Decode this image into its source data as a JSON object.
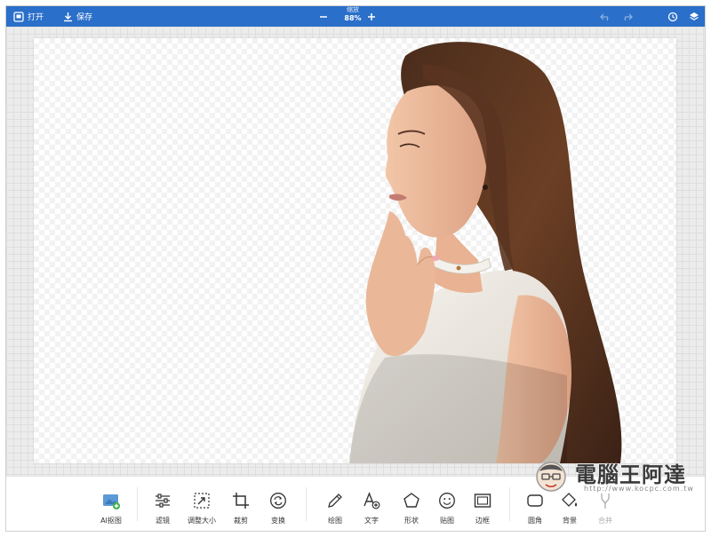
{
  "topbar": {
    "open_label": "打开",
    "save_label": "保存",
    "zoom_label": "缩放",
    "zoom_value": "88%",
    "accent_color": "#2a6fc9"
  },
  "tools": [
    {
      "label": "AI抠图",
      "icon": "ai-cutout-icon"
    },
    {
      "label": "滤镜",
      "icon": "sliders-icon"
    },
    {
      "label": "调整大小",
      "icon": "resize-icon"
    },
    {
      "label": "裁剪",
      "icon": "crop-icon"
    },
    {
      "label": "变换",
      "icon": "rotate-icon"
    },
    {
      "label": "绘图",
      "icon": "pencil-icon"
    },
    {
      "label": "文字",
      "icon": "text-icon"
    },
    {
      "label": "形状",
      "icon": "shape-icon"
    },
    {
      "label": "贴图",
      "icon": "sticker-icon"
    },
    {
      "label": "边框",
      "icon": "frame-icon"
    },
    {
      "label": "圆角",
      "icon": "rounded-corner-icon"
    },
    {
      "label": "背景",
      "icon": "background-icon"
    },
    {
      "label": "合并",
      "icon": "merge-icon"
    }
  ],
  "watermark": {
    "title": "電腦王阿達",
    "url": "http://www.kocpc.com.tw"
  }
}
